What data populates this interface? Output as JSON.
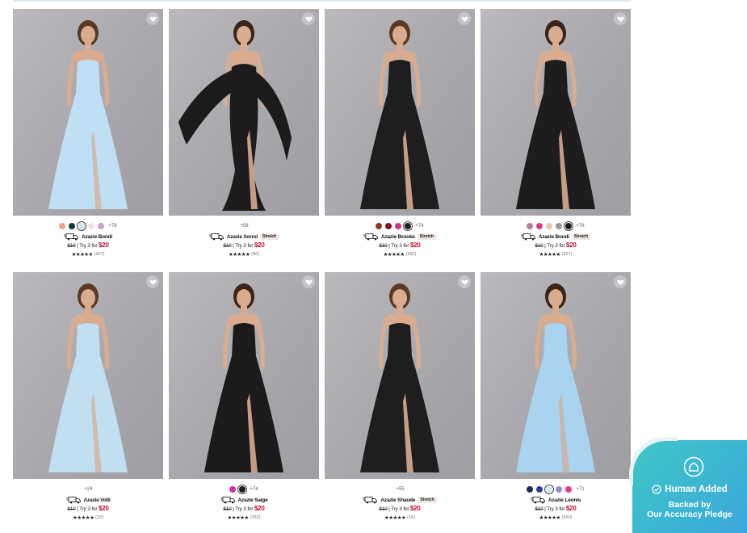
{
  "colors": {
    "price_accent": "#c4103a",
    "badge_bg": "#f1e7e4",
    "widget_gradient_start": "#3fc7c6",
    "widget_gradient_end": "#3aa7db"
  },
  "icons": {
    "favorite": "heart-icon",
    "shipping": "truck-icon",
    "rating": "star-icon",
    "widget_logo": "pledge-shield-icon",
    "widget_check": "check-circle-icon"
  },
  "products": [
    {
      "name": "Azazie Bondi",
      "dress_color": "#bfe0f4",
      "swatches": [
        "#f4a08a",
        "#0f3b36",
        "#cfe7f5",
        "#f3e1e1",
        "#c9a6c9"
      ],
      "selected_swatch": 2,
      "more_colors": "+78",
      "truck": true,
      "stretch": "",
      "old_price": "$10",
      "price_text": " | Try 3 for ",
      "promo_price": "$20",
      "stars": "★★★★★",
      "reviews": "(927)"
    },
    {
      "name": "Azazie Sorrel",
      "dress_color": "#1c1c1d",
      "swatches": [],
      "selected_swatch": -1,
      "more_colors": "+58",
      "truck": true,
      "stretch": "Stretch",
      "old_price": "$10",
      "price_text": " | Try 3 for ",
      "promo_price": "$20",
      "stars": "★★★★★",
      "reviews": "(88)"
    },
    {
      "name": "Azazie Brooke",
      "dress_color": "#1e1e1f",
      "swatches": [
        "#8b3a1d",
        "#7a1726",
        "#d62f8c",
        "#1d1d1d"
      ],
      "selected_swatch": 3,
      "more_colors": "+74",
      "truck": true,
      "stretch": "Stretch",
      "old_price": "$10",
      "price_text": " | Try 3 for ",
      "promo_price": "$20",
      "stars": "★★★★★",
      "reviews": "(582)"
    },
    {
      "name": "Azazie Bondi",
      "dress_color": "#1d1d1e",
      "swatches": [
        "#b57e98",
        "#d9408d",
        "#e8c9b0",
        "#9a9a9a",
        "#1c1c1c"
      ],
      "selected_swatch": 4,
      "more_colors": "+76",
      "truck": true,
      "stretch": "Stretch",
      "old_price": "$10",
      "price_text": " | Try 3 for ",
      "promo_price": "$20",
      "stars": "★★★★★",
      "reviews": "(927)"
    },
    {
      "name": "Azazie Volli",
      "dress_color": "#c0dff1",
      "swatches": [],
      "selected_swatch": -1,
      "more_colors": "+24",
      "truck": true,
      "stretch": "",
      "old_price": "$10",
      "price_text": " | Try 3 for ",
      "promo_price": "$20",
      "stars": "★★★★★",
      "reviews": "(20)"
    },
    {
      "name": "Azazie Saige",
      "dress_color": "#1b1b1c",
      "swatches": [
        "#cf3397",
        "#1c1c1c"
      ],
      "selected_swatch": 1,
      "more_colors": "+74",
      "truck": true,
      "stretch": "",
      "old_price": "$10",
      "price_text": " | Try 3 for ",
      "promo_price": "$20",
      "stars": "★★★★★",
      "reviews": "(332)"
    },
    {
      "name": "Azazie Shaude",
      "dress_color": "#1e1e1f",
      "swatches": [],
      "selected_swatch": -1,
      "more_colors": "+55",
      "truck": true,
      "stretch": "Stretch",
      "old_price": "$10",
      "price_text": " | Try 3 for ",
      "promo_price": "$20",
      "stars": "★★★★★",
      "reviews": "(16)"
    },
    {
      "name": "Azazie Leonis",
      "dress_color": "#a9d3ee",
      "swatches": [
        "#1e2a55",
        "#2c3a9e",
        "#cfe7f5",
        "#9e8ad0",
        "#d9408d"
      ],
      "selected_swatch": 2,
      "more_colors": "+71",
      "truck": true,
      "stretch": "",
      "old_price": "$10",
      "price_text": " | Try 3 for ",
      "promo_price": "$20",
      "stars": "★★★★★",
      "reviews": "(390)"
    }
  ],
  "widget": {
    "title": "Human Added",
    "line1": "Backed by",
    "line2": "Our Accuracy Pledge"
  }
}
